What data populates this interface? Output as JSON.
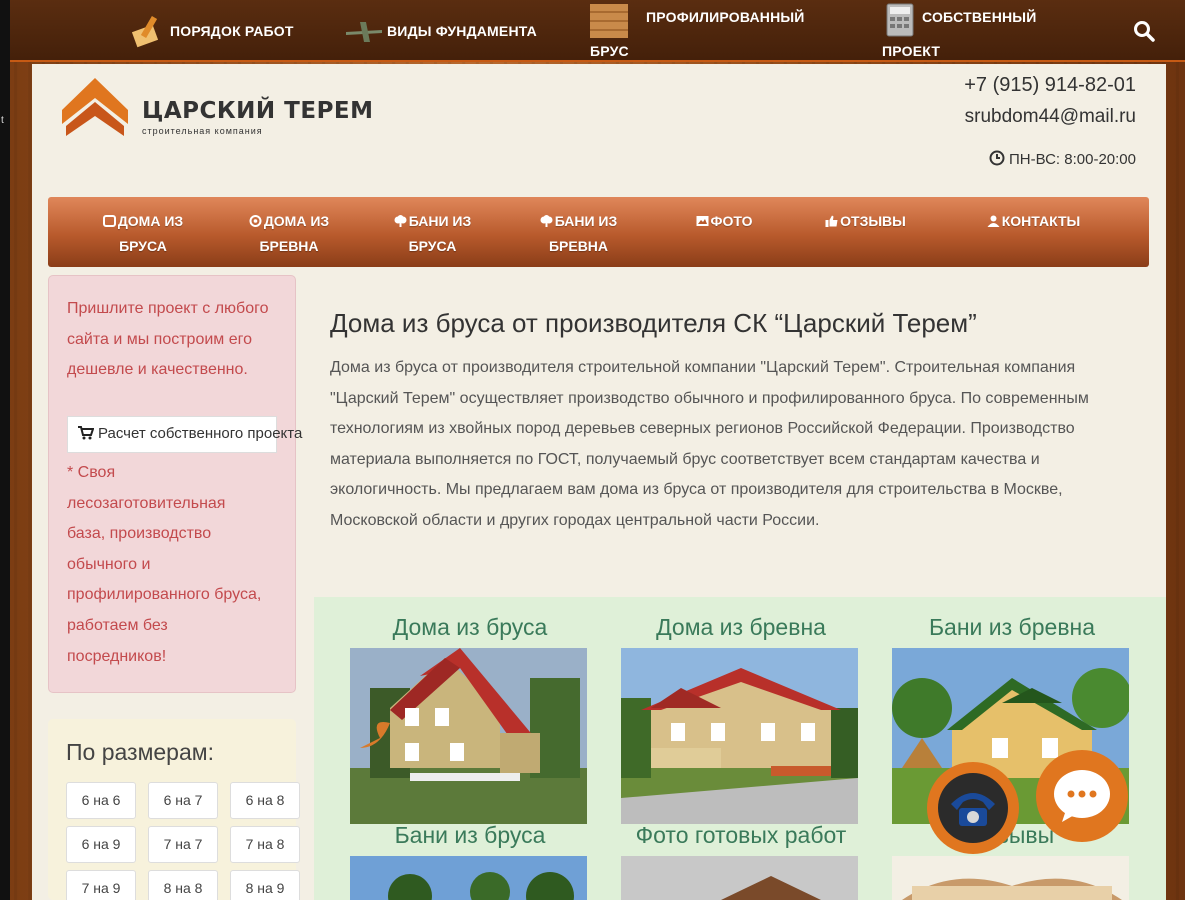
{
  "top_nav": {
    "items": [
      {
        "label": "ПОРЯДОК РАБОТ",
        "icon": "hammer-icon"
      },
      {
        "label": "ВИДЫ ФУНДАМЕНТА",
        "icon": "airplane-icon"
      },
      {
        "label_line1": "ПРОФИЛИРОВАННЫЙ",
        "label_line2": "БРУС",
        "icon": "wood-icon"
      },
      {
        "label_line1": "СОБСТВЕННЫЙ",
        "label_line2": "ПРОЕКТ",
        "icon": "calculator-icon"
      }
    ],
    "search_icon": "search-icon"
  },
  "header": {
    "logo_name": "ЦАРСКИЙ ТЕРЕМ",
    "logo_tagline": "строительная компания",
    "phone": "+7 (915) 914-82-01",
    "email": "srubdom44@mail.ru",
    "hours": "ПН-ВС: 8:00-20:00"
  },
  "main_nav": [
    {
      "line1": "ДОМА ИЗ",
      "line2": "БРУСА",
      "icon": "square-icon"
    },
    {
      "line1": "ДОМА ИЗ",
      "line2": "БРЕВНА",
      "icon": "target-icon"
    },
    {
      "line1": "БАНИ ИЗ",
      "line2": "БРУСА",
      "icon": "tree-icon"
    },
    {
      "line1": "БАНИ ИЗ",
      "line2": "БРЕВНА",
      "icon": "tree-icon"
    },
    {
      "line1": "ФОТО",
      "line2": "",
      "icon": "picture-icon"
    },
    {
      "line1": "ОТЗЫВЫ",
      "line2": "",
      "icon": "thumbs-up-icon"
    },
    {
      "line1": "КОНТАКТЫ",
      "line2": "",
      "icon": "user-icon"
    }
  ],
  "sidebar": {
    "promo_text": "Пришлите проект с любого сайта и мы построим его дешевле и качественно.",
    "calc_button": "Расчет собственного проекта",
    "promo_note": "* Своя лесозаготовительная база, производство обычного и профилированного бруса, работаем без посредников!",
    "sizes_heading": "По размерам:",
    "sizes": [
      "6 на 6",
      "6 на 7",
      "6 на 8",
      "6 на 9",
      "7 на 7",
      "7 на 8",
      "7 на 9",
      "8 на 8",
      "8 на 9"
    ]
  },
  "content": {
    "title": "Дома из бруса от производителя СК “Царский Терем”",
    "intro": "Дома из бруса от производителя строительной компании \"Царский Терем\". Строительная компания \"Царский Терем\" осуществляет производство обычного и профилированного бруса. По современным технологиям из хвойных пород деревьев северных регионов Российской Федерации. Производство материала выполняется по ГОСТ, получаемый брус соответствует всем стандартам качества и экологичность. Мы предлагаем вам дома из бруса от производителя для строительства в Москве, Московской области и других городах центральной части России."
  },
  "gallery": [
    {
      "title": "Дома из бруса"
    },
    {
      "title": "Дома из бревна"
    },
    {
      "title": "Бани из бревна"
    },
    {
      "title": "Бани из бруса"
    },
    {
      "title": "Фото готовых работ"
    },
    {
      "title": "Отзывы"
    }
  ],
  "floating": {
    "call_icon": "phone-icon",
    "chat_icon": "chat-icon"
  },
  "colors": {
    "accent": "#e0761f",
    "nav_dark": "#44200a",
    "promo_text": "#c34a4d",
    "gallery_bg": "#dff0d8"
  }
}
